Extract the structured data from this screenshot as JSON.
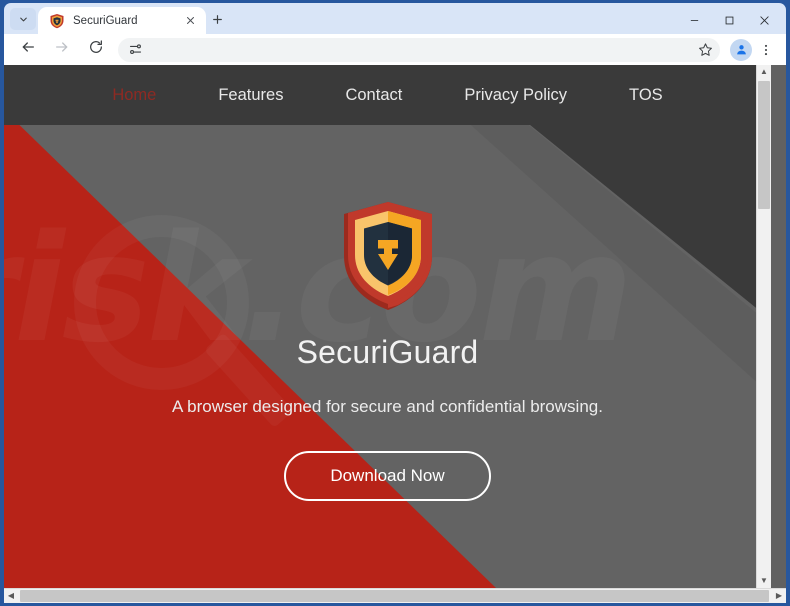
{
  "browser": {
    "tab": {
      "title": "SecuriGuard",
      "favicon_icon": "shield-favicon",
      "close_icon": "close-icon"
    },
    "tablist_icon": "chevron-down-icon",
    "newtab_label": "+",
    "newtab_icon": "plus-icon",
    "window_controls": {
      "minimize_icon": "minimize-icon",
      "maximize_icon": "maximize-icon",
      "close_icon": "window-close-icon"
    },
    "toolbar": {
      "back_icon": "back-arrow-icon",
      "forward_icon": "forward-arrow-icon",
      "reload_icon": "reload-icon",
      "omnibox_icon": "tune-icon",
      "address_value": "",
      "address_placeholder": "",
      "bookmark_icon": "star-icon",
      "profile_icon": "profile-avatar-icon",
      "menu_icon": "kebab-menu-icon"
    },
    "scrollbar": {
      "up_arrow": "▲",
      "down_arrow": "▼",
      "left_arrow": "◀",
      "right_arrow": "▶"
    }
  },
  "site": {
    "nav": [
      {
        "label": "Home",
        "active": true
      },
      {
        "label": "Features",
        "active": false
      },
      {
        "label": "Contact",
        "active": false
      },
      {
        "label": "Privacy Policy",
        "active": false
      },
      {
        "label": "TOS",
        "active": false
      }
    ],
    "hero": {
      "logo_icon": "securiguard-shield-logo",
      "brand": "SecuriGuard",
      "tagline": "A browser designed for secure and confidential browsing.",
      "cta_label": "Download Now"
    },
    "watermark": "risk.com",
    "colors": {
      "nav_background": "#3a3a3a",
      "page_background": "#636363",
      "accent_red": "#b72318",
      "active_link": "#8e2a23",
      "shield_outer": "#c0392b",
      "shield_outer_dark": "#9c2a1e",
      "shield_inner": "#f5a623",
      "shield_inner_light": "#f9c46b",
      "shield_core": "#22313f",
      "text_light": "#f2f2f2"
    }
  }
}
